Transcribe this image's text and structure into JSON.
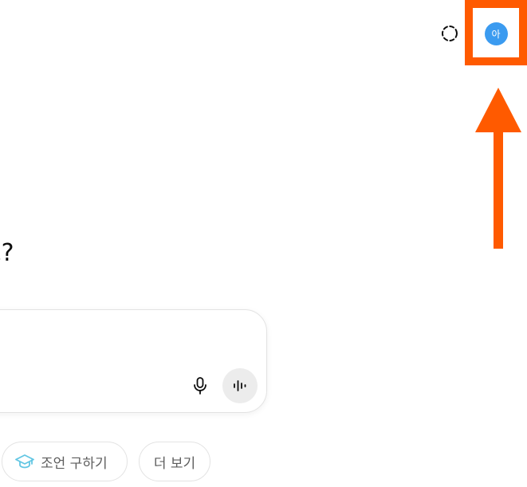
{
  "header": {
    "temporary_chat_icon": "dashed-circle-icon",
    "avatar_initial": "아"
  },
  "main": {
    "headline": "요?"
  },
  "composer": {
    "placeholder": "",
    "mic_icon": "microphone-icon",
    "voice_icon": "voice-waveform-icon"
  },
  "suggestions": [
    {
      "label": "조언 구하기",
      "icon": "graduation-cap-icon",
      "icon_color": "#62c6e3"
    },
    {
      "label": "더 보기"
    }
  ],
  "annotation": {
    "highlight_color": "#ff5a00",
    "arrow_color": "#ff5a00"
  }
}
